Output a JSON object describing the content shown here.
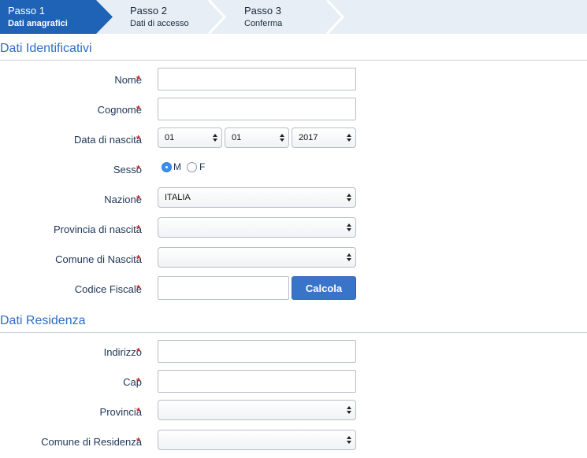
{
  "steps": [
    {
      "title": "Passo 1",
      "subtitle": "Dati anagrafici",
      "active": true
    },
    {
      "title": "Passo 2",
      "subtitle": "Dati di accesso",
      "active": false
    },
    {
      "title": "Passo 3",
      "subtitle": "Conferma",
      "active": false
    }
  ],
  "colors": {
    "active_step": "#1e63b5",
    "step_bar": "#e8eef6",
    "section_title": "#2e6dc2",
    "required": "#c62828",
    "button": "#3a74c9"
  },
  "sections": {
    "identificativi": {
      "title": "Dati Identificativi"
    },
    "residenza": {
      "title": "Dati Residenza"
    }
  },
  "required_mark": "*",
  "fields": {
    "nome": {
      "label": "Nome",
      "value": ""
    },
    "cognome": {
      "label": "Cognome",
      "value": ""
    },
    "data_nascita": {
      "label": "Data di nascita",
      "day": "01",
      "month": "01",
      "year": "2017"
    },
    "sesso": {
      "label": "Sesso",
      "option_m": "M",
      "option_f": "F",
      "selected": "M"
    },
    "nazione": {
      "label": "Nazione",
      "value": "ITALIA"
    },
    "provincia_nascita": {
      "label": "Provincia di nascita",
      "value": ""
    },
    "comune_nascita": {
      "label": "Comune di Nascita",
      "value": ""
    },
    "codice_fiscale": {
      "label": "Codice Fiscale",
      "value": "",
      "button": "Calcola"
    },
    "indirizzo": {
      "label": "Indirizzo",
      "value": ""
    },
    "cap": {
      "label": "Cap",
      "value": ""
    },
    "provincia": {
      "label": "Provincia",
      "value": ""
    },
    "comune_residenza": {
      "label": "Comune di Residenza",
      "value": ""
    }
  }
}
